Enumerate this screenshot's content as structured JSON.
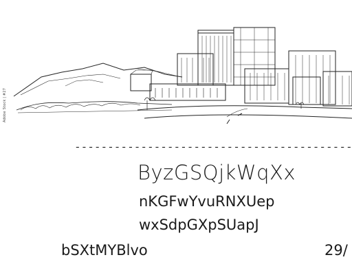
{
  "illustration": {
    "subject": "city skyline sketch",
    "credit": "Adobe Stock | #277825"
  },
  "divider": {
    "text": "-------------------------------------------------------------"
  },
  "text": {
    "title": "ByzGSQjkWqXx",
    "line_1": "nKGFwYvuRNXUep",
    "line_2": "wxSdpGXpSUapJ",
    "bottom_left": "bSXtMYBlvo",
    "bottom_right": "29/"
  },
  "colors": {
    "background": "#ffffff",
    "ink": "#1a1a1a"
  }
}
